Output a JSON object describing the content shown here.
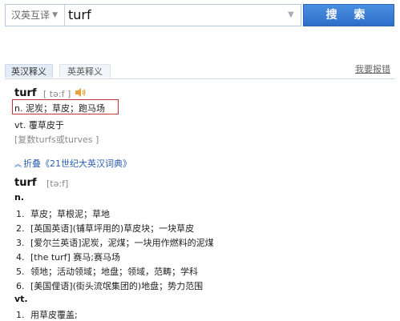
{
  "search": {
    "language": "汉英互译",
    "query": "turf",
    "button_label": "搜 索"
  },
  "tabs": [
    {
      "label": "英汉释义",
      "active": true
    },
    {
      "label": "英英释义",
      "active": false
    }
  ],
  "report_link": "我要报错",
  "entry": {
    "word": "turf",
    "phonetic": "[ tə:f ]",
    "definitions": [
      "n. 泥炭；草皮；跑马场",
      "vt. 覆草皮于"
    ],
    "plural_note": "[复数turfs或turves ]"
  },
  "collapse_label": "折叠《21世纪大英汉词典》",
  "dictionary": {
    "word": "turf",
    "phonetic": "[tə:f]",
    "pos_n": "n.",
    "senses_n": [
      {
        "num": "1.",
        "text": "草皮；草根泥；草地"
      },
      {
        "num": "2.",
        "text": "[英国英语](铺草坪用的)草皮块；一块草皮"
      },
      {
        "num": "3.",
        "text": "[爱尔兰英语]泥炭，泥煤；一块用作燃料的泥煤"
      },
      {
        "num": "4.",
        "text": "[the turf] 赛马;赛马场"
      },
      {
        "num": "5.",
        "text": "领地；活动领域；地盘；领域，范畴；学科"
      },
      {
        "num": "6.",
        "text": "[美国俚语](街头流氓集团的)地盘；势力范围"
      }
    ],
    "pos_vt": "vt.",
    "senses_vt": [
      {
        "num": "1.",
        "text": "用草皮覆盖;"
      }
    ]
  }
}
